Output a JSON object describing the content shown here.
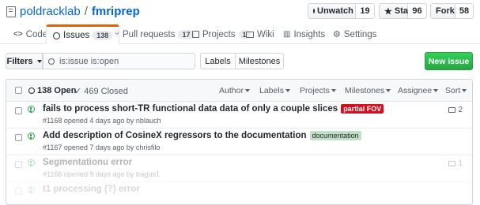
{
  "repo": {
    "owner": "poldracklab",
    "separator": "/",
    "name": "fmriprep"
  },
  "actions": {
    "watch": {
      "label": "Unwatch",
      "count": "19"
    },
    "star": {
      "label": "Star",
      "count": "96"
    },
    "fork": {
      "label": "Fork",
      "count": "58"
    }
  },
  "tabs": [
    {
      "label": "Code",
      "icon": "code-icon"
    },
    {
      "label": "Issues",
      "count": "138",
      "icon": "issue-icon",
      "selected": true
    },
    {
      "label": "Pull requests",
      "count": "17",
      "icon": "pull-request-icon"
    },
    {
      "label": "Projects",
      "count": "1",
      "icon": "project-icon"
    },
    {
      "label": "Wiki",
      "icon": "book-icon"
    },
    {
      "label": "Insights",
      "icon": "graph-icon"
    },
    {
      "label": "Settings",
      "icon": "gear-icon"
    }
  ],
  "filters": {
    "filters_label": "Filters",
    "search_value": "is:issue is:open",
    "labels_label": "Labels",
    "milestones_label": "Milestones",
    "new_issue_label": "New issue"
  },
  "list_header": {
    "open_label": "138 Open",
    "closed_label": "469 Closed",
    "sorts": [
      "Author",
      "Labels",
      "Projects",
      "Milestones",
      "Assignee",
      "Sort"
    ]
  },
  "issues": [
    {
      "title": "fails to process short-TR functional data data of only a couple slices",
      "label": "partial FOV",
      "label_color": "#d60f1c",
      "label_text_color": "#ffffff",
      "meta": "#1168 opened 4 days ago by nblauch",
      "comments": "2"
    },
    {
      "title": "Add description of CosineX regressors to the documentation",
      "label": "documentation",
      "label_color": "#c2e0c6",
      "label_text_color": "#24292e",
      "meta": "#1167 opened 7 days ago by chrisfilo",
      "comments": ""
    },
    {
      "title": "Segmentationu error",
      "label": "",
      "label_color": "",
      "label_text_color": "",
      "meta": "#1166 opened 9 days ago by tragus1",
      "comments": "1"
    },
    {
      "title": "t1 processing (?) error",
      "label": "",
      "label_color": "",
      "label_text_color": "",
      "meta": "",
      "comments": ""
    }
  ]
}
